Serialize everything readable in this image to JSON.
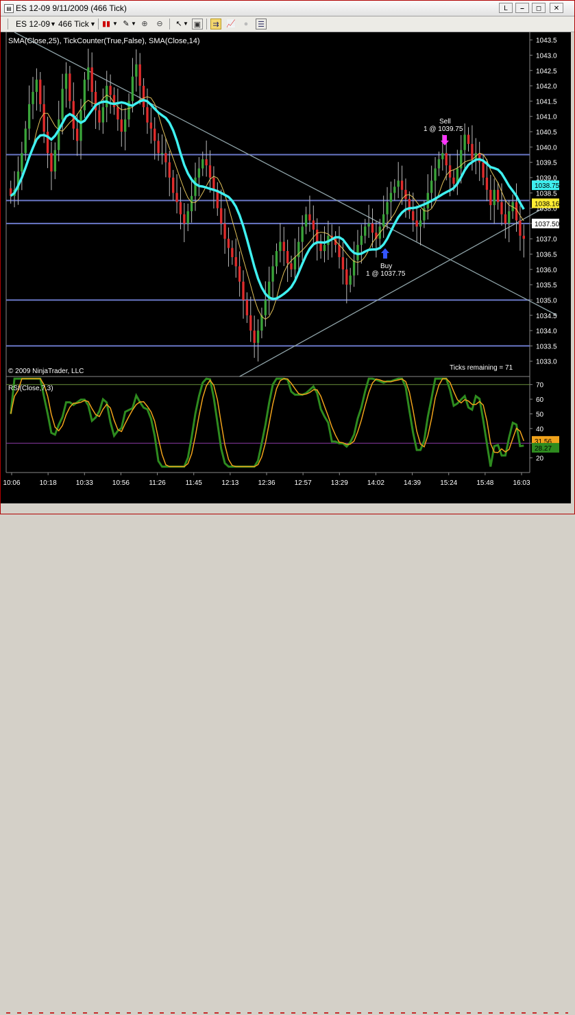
{
  "window": {
    "title": "ES 12-09  9/11/2009 (466 Tick)",
    "buttons": [
      "L",
      "⎯",
      "◻",
      "✕"
    ]
  },
  "toolbar": {
    "instrument": "ES 12-09",
    "interval": "466 Tick"
  },
  "colors": {
    "background": "#000000",
    "up_bar": "#3aa43a",
    "down_bar": "#e02c2c",
    "sma25": "#3ff0f0",
    "sma14": "#e3c25a",
    "hline": "#6a78c8",
    "trendline": "#8fa3a8",
    "rsi_line": "#2e8b1f",
    "rsi_signal": "#f0a21b",
    "sell_marker": "#ff33ff",
    "buy_marker": "#3355ff"
  },
  "price_panel": {
    "indicator_label": "SMA(Close,25), TickCounter(True,False), SMA(Close,14)",
    "copyright": "© 2009 NinjaTrader, LLC",
    "ticks_remaining": "Ticks remaining = 71",
    "sell_label": "Sell",
    "sell_detail": "1 @ 1039.75",
    "buy_label": "Buy",
    "buy_detail": "1 @ 1037.75",
    "price_flags": [
      {
        "value": "1038.75",
        "bg": "#3ff0f0",
        "fg": "#000000"
      },
      {
        "value": "1038.16",
        "bg": "#ffee33",
        "fg": "#000000"
      },
      {
        "value": "1037.50",
        "bg": "#ffffff",
        "fg": "#000000"
      }
    ]
  },
  "rsi_panel": {
    "indicator_label": "RSI(Close,7,3)",
    "flags": [
      {
        "value": "31.56",
        "bg": "#f0a21b",
        "fg": "#000000"
      },
      {
        "value": "28.27",
        "bg": "#2e8b1f",
        "fg": "#000000"
      }
    ]
  },
  "chart_data": [
    {
      "type": "candlestick",
      "title": "SMA(Close,25), TickCounter(True,False), SMA(Close,14)",
      "ylim": [
        1032.5,
        1043.75
      ],
      "y_ticks": [
        "1033.0",
        "1033.5",
        "1034.0",
        "1034.5",
        "1035.0",
        "1035.5",
        "1036.0",
        "1036.5",
        "1037.0",
        "1037.5",
        "1038.0",
        "1038.5",
        "1039.0",
        "1039.5",
        "1040.0",
        "1040.5",
        "1041.0",
        "1041.5",
        "1042.0",
        "1042.5",
        "1043.0",
        "1043.5"
      ],
      "x_ticks": [
        "10:06",
        "10:18",
        "10:33",
        "10:56",
        "11:26",
        "11:45",
        "12:13",
        "12:36",
        "12:57",
        "13:29",
        "14:02",
        "14:39",
        "15:24",
        "15:48",
        "16:03"
      ],
      "horizontal_lines": [
        1039.75,
        1038.25,
        1037.5,
        1035.0,
        1033.5
      ],
      "trendlines": [
        {
          "from": [
            1,
            1043.75
          ],
          "to": [
            148,
            1034.5
          ]
        },
        {
          "from": [
            62,
            1032.5
          ],
          "to": [
            148,
            1038.25
          ]
        }
      ],
      "close_path": [
        1038.4,
        1038.6,
        1039.2,
        1039.8,
        1040.6,
        1041.4,
        1041.8,
        1042.2,
        1041.4,
        1040.5,
        1039.8,
        1039.2,
        1039.9,
        1040.9,
        1041.9,
        1042.4,
        1041.5,
        1040.6,
        1040.2,
        1041.2,
        1042.2,
        1042.6,
        1041.8,
        1041.2,
        1040.8,
        1041.3,
        1042.0,
        1041.7,
        1041.3,
        1040.9,
        1040.5,
        1040.9,
        1041.5,
        1042.3,
        1042.7,
        1042.0,
        1041.3,
        1040.8,
        1040.6,
        1040.2,
        1039.8,
        1039.8,
        1039.5,
        1039.0,
        1038.5,
        1038.2,
        1037.8,
        1037.5,
        1037.9,
        1038.4,
        1039.0,
        1039.3,
        1039.6,
        1039.4,
        1039.0,
        1038.6,
        1038.0,
        1037.5,
        1037.0,
        1036.7,
        1036.4,
        1036.1,
        1035.6,
        1035.0,
        1034.5,
        1034.0,
        1033.6,
        1034.0,
        1034.5,
        1035.0,
        1035.6,
        1036.1,
        1036.6,
        1036.9,
        1036.6,
        1036.2,
        1036.0,
        1036.4,
        1036.9,
        1037.4,
        1037.8,
        1037.6,
        1037.3,
        1036.9,
        1036.6,
        1036.8,
        1037.1,
        1037.0,
        1036.8,
        1036.4,
        1036.0,
        1035.5,
        1035.8,
        1036.3,
        1036.8,
        1037.1,
        1037.4,
        1037.5,
        1037.2,
        1037.0,
        1037.4,
        1037.8,
        1038.2,
        1038.5,
        1038.7,
        1038.9,
        1038.6,
        1038.3,
        1037.9,
        1037.6,
        1037.4,
        1037.6,
        1038.0,
        1038.5,
        1038.9,
        1039.3,
        1039.6,
        1039.8,
        1039.4,
        1039.0,
        1038.8,
        1039.3,
        1039.9,
        1040.4,
        1040.1,
        1039.6,
        1039.8,
        1039.5,
        1039.0,
        1038.6,
        1038.1,
        1038.6,
        1038.2,
        1037.8,
        1037.5,
        1037.9,
        1038.2,
        1037.6,
        1037.1,
        1037.0
      ]
    },
    {
      "type": "line",
      "title": "RSI(Close,7,3)",
      "ylim": [
        10,
        75
      ],
      "y_ticks": [
        "20",
        "30",
        "40",
        "50",
        "60",
        "70"
      ],
      "horizontal_lines": [
        70,
        30
      ],
      "last_values": {
        "rsi": 28.27,
        "signal": 31.56
      }
    }
  ]
}
